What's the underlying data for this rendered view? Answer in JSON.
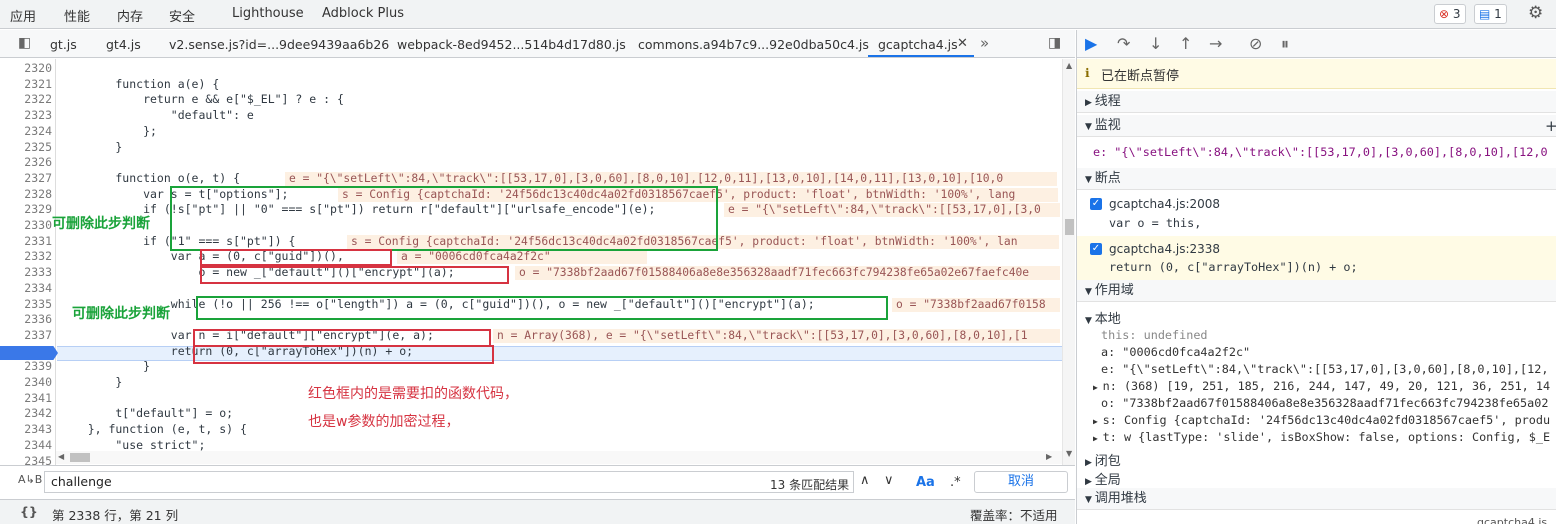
{
  "top_tabs": [
    "应用",
    "性能",
    "内存",
    "安全",
    "Lighthouse",
    "Adblock Plus"
  ],
  "badges": {
    "errors": "3",
    "messages": "1"
  },
  "file_tabs": [
    "gt.js",
    "gt4.js",
    "v2.sense.js?id=...9dee9439aa6b26",
    "webpack-8ed9452...514b4d17d80.js",
    "commons.a94b7c9...92e0dba50c4.js",
    "gcaptcha4.js"
  ],
  "line_numbers": [
    "2320",
    "2321",
    "2322",
    "2323",
    "2324",
    "2325",
    "2326",
    "2327",
    "2328",
    "2329",
    "2330",
    "2331",
    "2332",
    "2333",
    "2334",
    "2335",
    "2336",
    "2337",
    "2338",
    "2339",
    "2340",
    "2341",
    "2342",
    "2343",
    "2344",
    "2345"
  ],
  "code_lines": [
    "",
    "        function a(e) {",
    "            return e && e[\"$_EL\"] ? e : {",
    "                \"default\": e",
    "            };",
    "        }",
    "",
    "        function o(e, t) {",
    "            var s = t[\"options\"];",
    "            if (!s[\"pt\"] || \"0\" === s[\"pt\"]) return r[\"default\"][\"urlsafe_encode\"](e);",
    "",
    "            if (\"1\" === s[\"pt\"]) {",
    "                var a = (0, c[\"guid\"])(),",
    "                    o = new _[\"default\"]()[\"encrypt\"](a);",
    "",
    "                while (!o || 256 !== o[\"length\"]) a = (0, c[\"guid\"])(), o = new _[\"default\"]()[\"encrypt\"](a);",
    "",
    "                var n = i[\"default\"][\"encrypt\"](e, a);",
    "                return (0, c[\"arrayToHex\"])(n) + o;",
    "            }",
    "        }",
    "",
    "        t[\"default\"] = o;",
    "    }, function (e, t, s) {",
    "        \"use strict\";",
    ""
  ],
  "inline_values": [
    "e = \"{\\\"setLeft\\\":84,\\\"track\\\":[[53,17,0],[3,0,60],[8,0,10],[12,0,11],[13,0,10],[14,0,11],[13,0,10],[10,0",
    "s = Config {captchaId: '24f56dc13c40dc4a02fd0318567caef5', product: 'float', btnWidth: '100%', lang",
    "e = \"{\\\"setLeft\\\":84,\\\"track\\\":[[53,17,0],[3,0",
    "s = Config {captchaId: '24f56dc13c40dc4a02fd0318567caef5', product: 'float', btnWidth: '100%', lan",
    "a = \"0006cd0fca4a2f2c\"",
    "o = \"7338bf2aad67f01588406a8e8e356328aadf71fec663fc794238fe65a02e67faefc40e",
    "o = \"7338bf2aad67f0158",
    "n = Array(368), e = \"{\\\"setLeft\\\":84,\\\"track\\\":[[53,17,0],[3,0,60],[8,0,10],[1"
  ],
  "annotations": {
    "remove1": "可删除此步判断",
    "remove2": "可删除此步判断",
    "note1": "红色框内的是需要扣的函数代码，",
    "note2": "也是w参数的加密过程，"
  },
  "search": {
    "value": "challenge",
    "matches": "13 条匹配结果",
    "aa": "Aa",
    "regex": ".*",
    "cancel": "取消"
  },
  "status": {
    "position": "第 2338 行，第 21 列",
    "coverage": "覆盖率：不适用"
  },
  "right": {
    "paused": "已在断点暂停",
    "threads": "线程",
    "watch": "监视",
    "watch_expr": "e: \"{\\\"setLeft\\\":84,\\\"track\\\":[[53,17,0],[3,0,60],[8,0,10],[12,0",
    "breakpoints": "断点",
    "bp1_file": "gcaptcha4.js:2008",
    "bp1_code": "var o = this,",
    "bp2_file": "gcaptcha4.js:2338",
    "bp2_code": "return (0, c[\"arrayToHex\"])(n) + o;",
    "scope": "作用域",
    "local": "本地",
    "scope_lines": [
      "this: undefined",
      "a: \"0006cd0fca4a2f2c\"",
      "e: \"{\\\"setLeft\\\":84,\\\"track\\\":[[53,17,0],[3,0,60],[8,0,10],[12,",
      "n: (368) [19, 251, 185, 216, 244, 147, 49, 20, 121, 36, 251, 14",
      "o: \"7338bf2aad67f01588406a8e8e356328aadf71fec663fc794238fe65a02",
      "s: Config {captchaId: '24f56dc13c40dc4a02fd0318567caef5', produ",
      "t: w {lastType: 'slide', isBoxShow: false, options: Config, $_E"
    ],
    "closure": "闭包",
    "global": "全局",
    "callstack": "调用堆栈",
    "callstack_file": "gcaptcha4.js"
  }
}
